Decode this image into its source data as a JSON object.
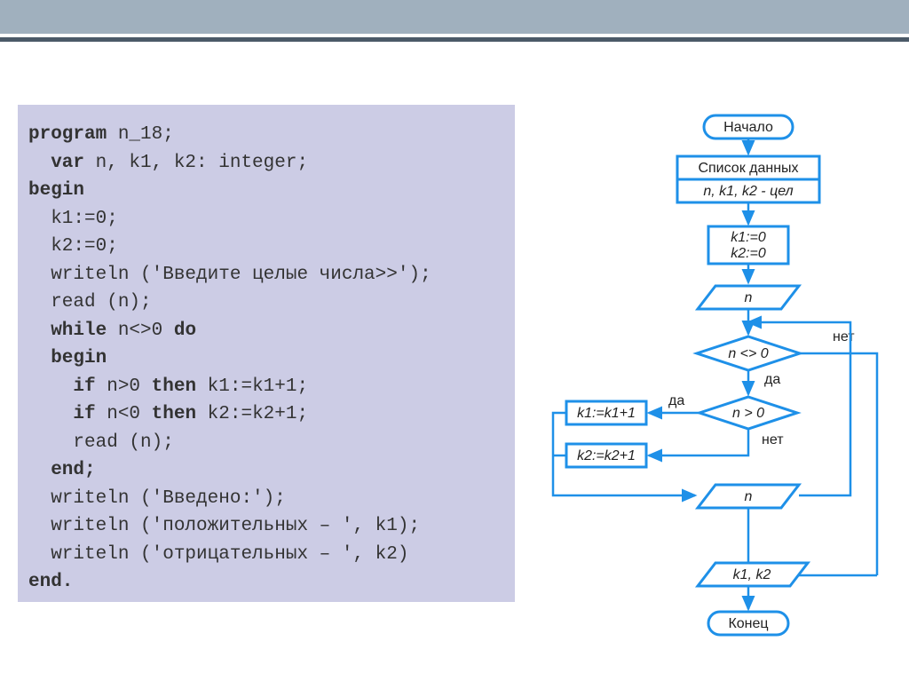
{
  "code": {
    "l1a": "program",
    "l1b": " n_18;",
    "l2a": "  var",
    "l2b": " n, k1, k2: integer;",
    "l3": "begin",
    "l4": "  k1:=0;",
    "l5": "  k2:=0;",
    "l6": "  writeln ('Введите целые числа>>');",
    "l7": "  read (n);",
    "l8a": "  while",
    "l8b": " n<>0 ",
    "l8c": "do",
    "l9": "  begin",
    "l10a": "    if",
    "l10b": " n>0 ",
    "l10c": "then",
    "l10d": " k1:=k1+1;",
    "l11a": "    if",
    "l11b": " n<0 ",
    "l11c": "then",
    "l11d": " k2:=k2+1;",
    "l12": "    read (n);",
    "l13": "  end;",
    "l14": "  writeln ('Введено:');",
    "l15": "  writeln ('положительных – ', k1);",
    "l16": "  writeln ('отрицательных – ', k2)",
    "l17": "end."
  },
  "fc": {
    "start": "Начало",
    "datalist": "Список данных",
    "vars": "n, k1, k2 - цел",
    "init1": "k1:=0",
    "init2": "k2:=0",
    "input_n": "n",
    "cond1": "n <> 0",
    "cond2": "n > 0",
    "yes": "да",
    "no": "нет",
    "inc1": "k1:=k1+1",
    "inc2": "k2:=k2+1",
    "input_n2": "n",
    "output": "k1, k2",
    "end": "Конец"
  }
}
